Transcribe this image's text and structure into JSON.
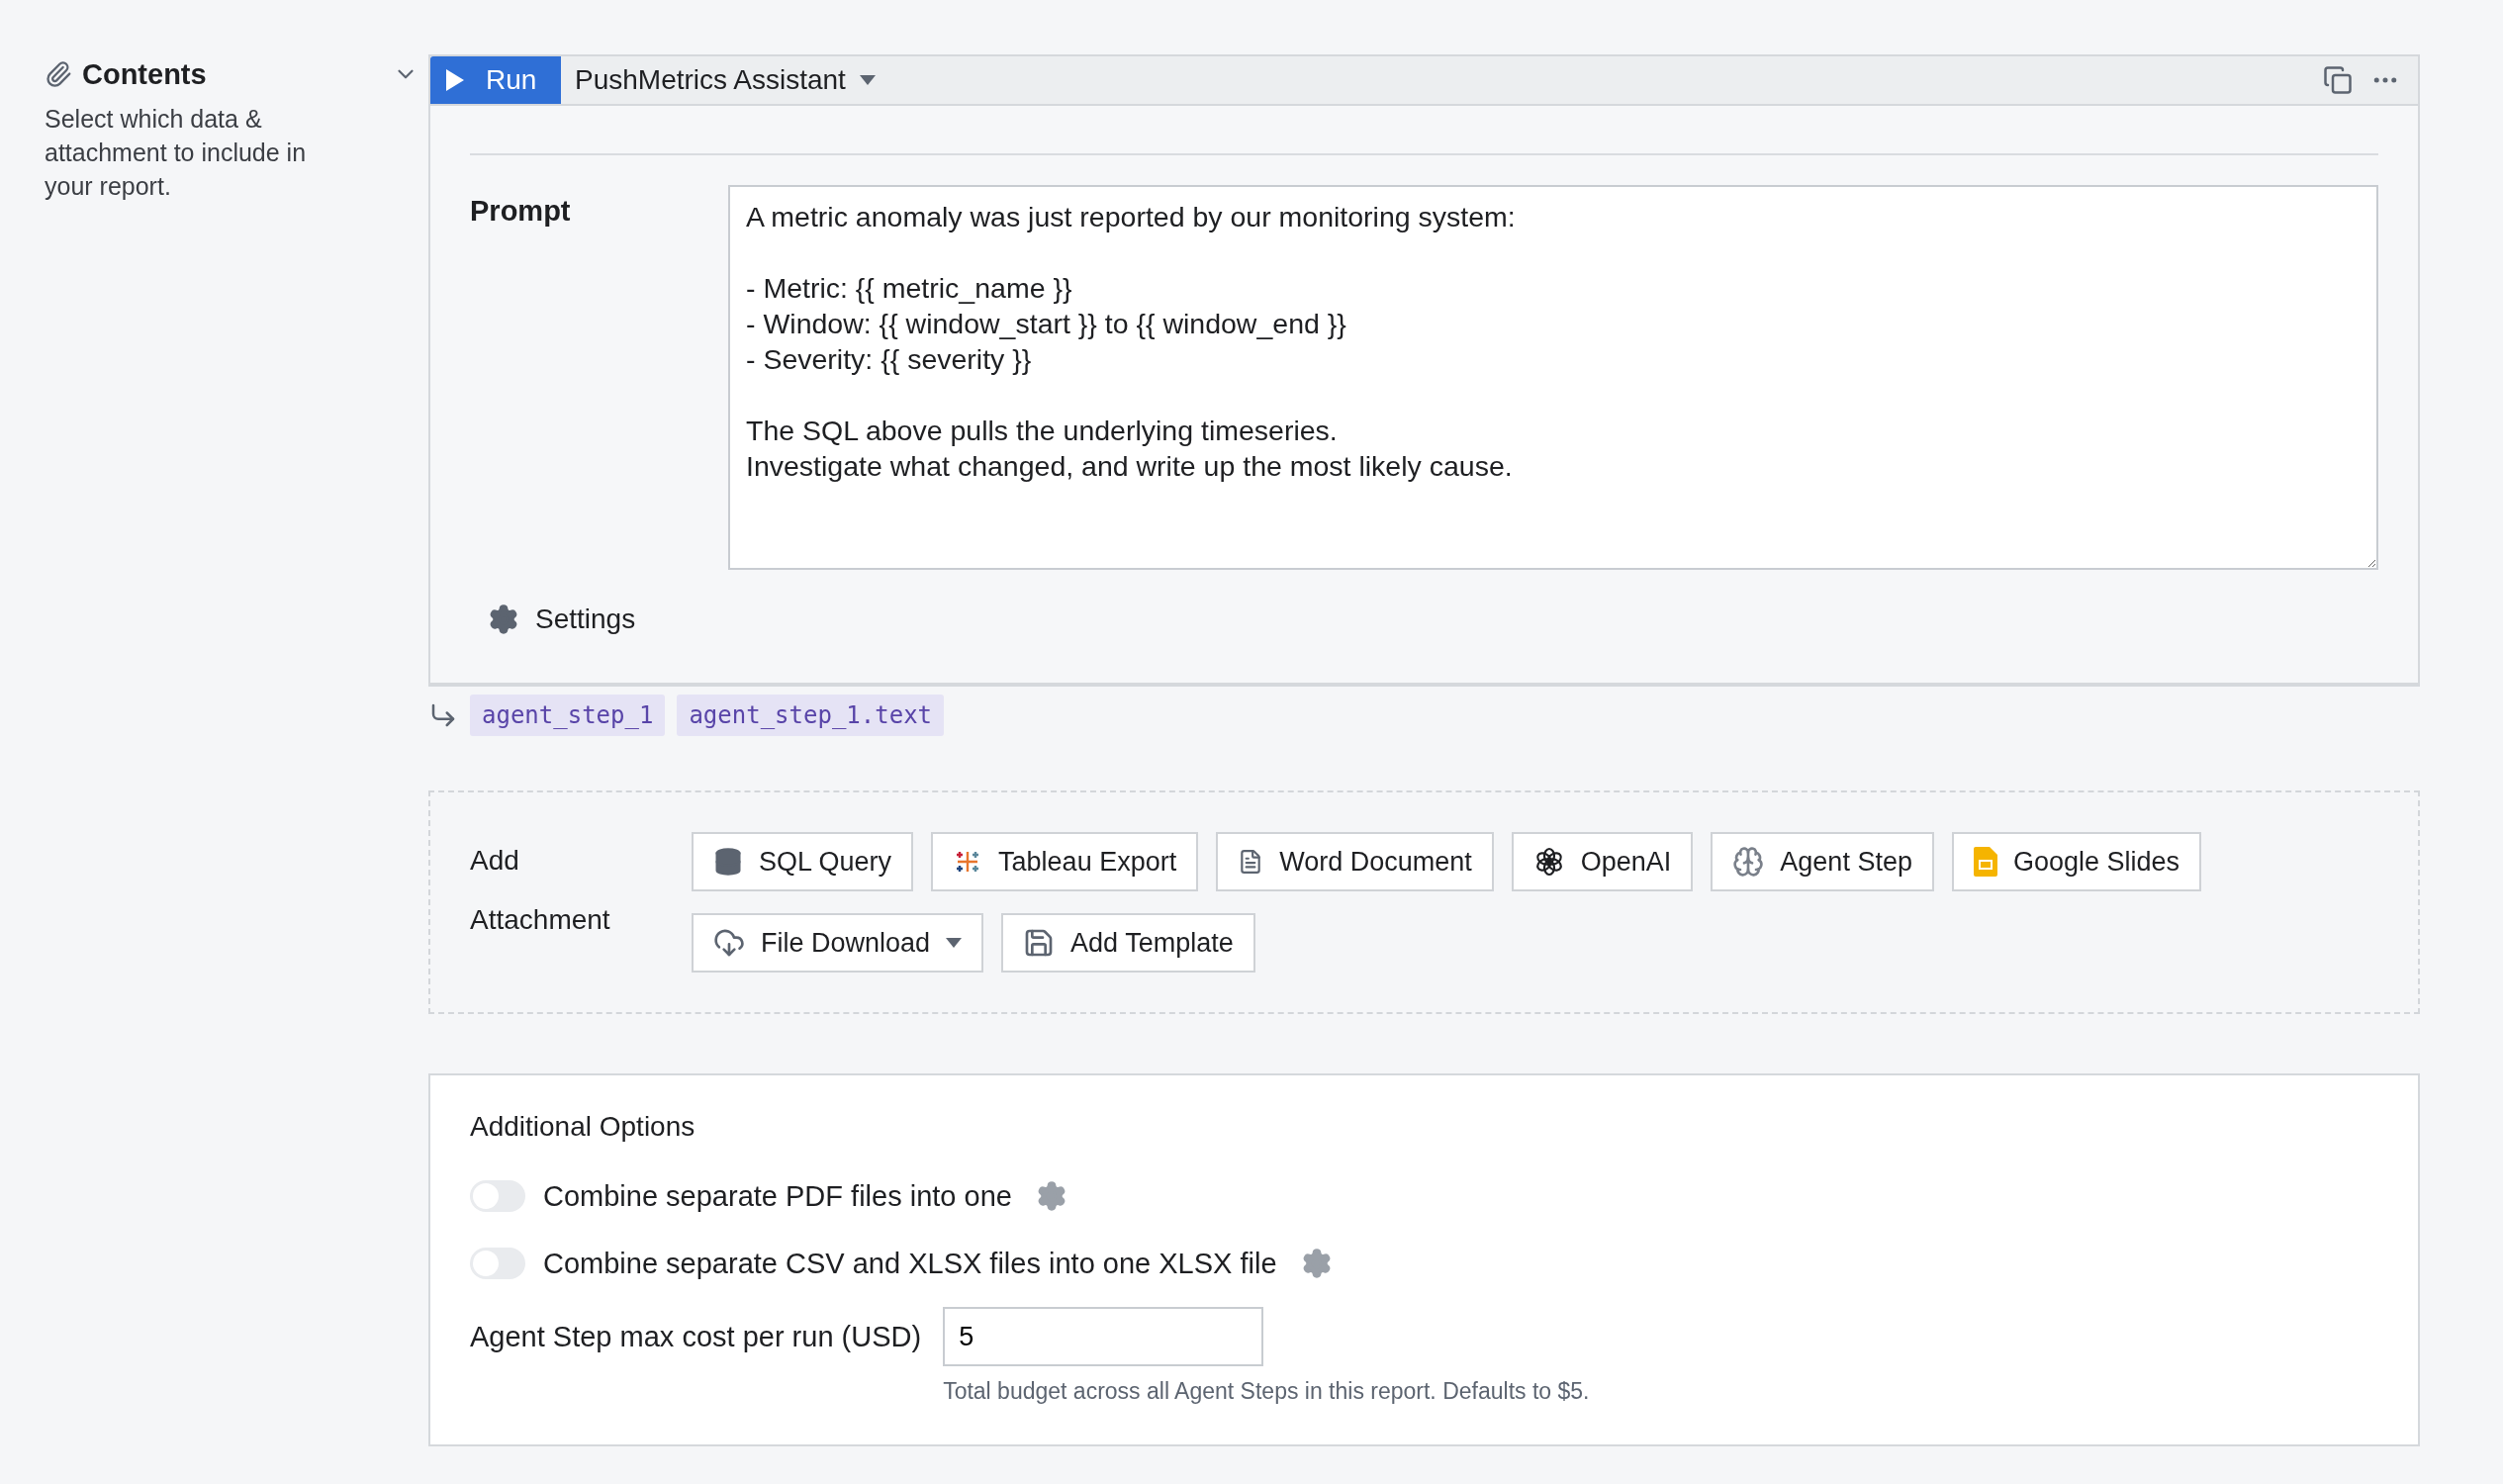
{
  "sidebar": {
    "title": "Contents",
    "description": "Select which data & attachment to include in your report.",
    "expanded": true
  },
  "block": {
    "run_button": "Run",
    "title": "PushMetrics Assistant",
    "prompt_label": "Prompt",
    "prompt_text": "A metric anomaly was just reported by our monitoring system:\n\n- Metric: {{ metric_name }}\n- Window: {{ window_start }} to {{ window_end }}\n- Severity: {{ severity }}\n\nThe SQL above pulls the underlying timeseries.\nInvestigate what changed, and write up the most likely cause.",
    "settings_label": "Settings"
  },
  "outputs": [
    "agent_step_1",
    "agent_step_1.text"
  ],
  "attachments": {
    "label": "Add Attachment",
    "buttons": [
      {
        "label": "SQL Query",
        "kind": "sql"
      },
      {
        "label": "Tableau Export",
        "kind": "tableau"
      },
      {
        "label": "Word Document",
        "kind": "word"
      },
      {
        "label": "OpenAI",
        "kind": "openai"
      },
      {
        "label": "Agent Step",
        "kind": "agent"
      },
      {
        "label": "Google Slides",
        "kind": "slides"
      },
      {
        "label": "File Download",
        "kind": "download",
        "dropdown": true
      },
      {
        "label": "Add Template",
        "kind": "template"
      }
    ]
  },
  "options": {
    "title": "Additional Options",
    "toggles": [
      {
        "label": "Combine separate PDF files into one",
        "on": false
      },
      {
        "label": "Combine separate CSV and XLSX files into one XLSX file",
        "on": false
      }
    ],
    "cost": {
      "label": "Agent Step max cost per run (USD)",
      "value": "5",
      "hint": "Total budget across all Agent Steps in this report. Defaults to $5."
    }
  }
}
